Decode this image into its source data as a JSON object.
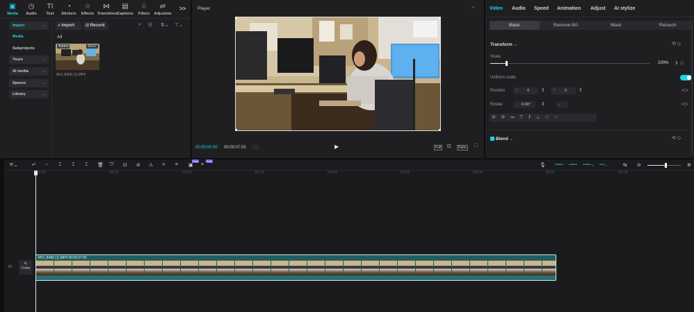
{
  "toolbar": {
    "items": [
      {
        "label": "Media",
        "icon": "media-icon",
        "glyph": "▣"
      },
      {
        "label": "Audio",
        "icon": "audio-icon",
        "glyph": "◷"
      },
      {
        "label": "Text",
        "icon": "text-icon",
        "glyph": "TI"
      },
      {
        "label": "Stickers",
        "icon": "stickers-icon",
        "glyph": "◔"
      },
      {
        "label": "Effects",
        "icon": "effects-icon",
        "glyph": "☆"
      },
      {
        "label": "Transitions",
        "icon": "transitions-icon",
        "glyph": "⋈"
      },
      {
        "label": "Captions",
        "icon": "captions-icon",
        "glyph": "▤"
      },
      {
        "label": "Filters",
        "icon": "filters-icon",
        "glyph": "♧"
      },
      {
        "label": "Adjustme",
        "icon": "adjustment-icon",
        "glyph": "⇌"
      }
    ],
    "more": ">>"
  },
  "sidebar": {
    "items": [
      {
        "label": "Import",
        "chevron": "⌄"
      },
      {
        "label": "Media",
        "chevron": ""
      },
      {
        "label": "Subprojects",
        "chevron": ""
      },
      {
        "label": "Yours",
        "chevron": "⌄"
      },
      {
        "label": "AI media",
        "chevron": "⌄"
      },
      {
        "label": "Spaces",
        "chevron": "⌄"
      },
      {
        "label": "Library",
        "chevron": "⌄"
      }
    ]
  },
  "media": {
    "import_label": "Import",
    "record_label": "Record",
    "filter_all": "All",
    "clip_badge_added": "Added",
    "clip_duration": "00:07",
    "clip_name": "MVI_8496 (1).MP4"
  },
  "player": {
    "title": "Player",
    "time_current": "00:00:00:00",
    "time_total": "00:00:07:05",
    "full_label": "Full",
    "ratio_label": "Ratio"
  },
  "inspector": {
    "tabs": [
      "Video",
      "Audio",
      "Speed",
      "Animation",
      "Adjust",
      "AI stylize"
    ],
    "subtabs": [
      "Basic",
      "Remove BG",
      "Mask",
      "Retouch"
    ],
    "transform_label": "Transform",
    "scale_label": "Scale",
    "scale_value": "100%",
    "scale_fraction": 0.1,
    "uniform_scale_label": "Uniform scale",
    "uniform_scale_on": true,
    "position_label": "Position",
    "pos_x_label": "X",
    "pos_x_value": "0",
    "pos_y_label": "Y",
    "pos_y_value": "0",
    "rotate_label": "Rotate",
    "rotate_value": "0.00°",
    "rotate_extra": "-",
    "blend_label": "Blend"
  },
  "timeline": {
    "ruler": [
      "00:00",
      "|00:01",
      "|00:02",
      "|00:03",
      "|00:04",
      "|00:05",
      "|00:06",
      "|00:07",
      "|00:08"
    ],
    "clip_label": "MVI_8496 (1).MP4  00:00:07:05",
    "cover_label": "Cover",
    "zoom_fraction": 0.55,
    "tool_badge_1": "Free",
    "tool_badge_2": "Free"
  },
  "colors": {
    "accent": "#22d3e6",
    "panel": "#1f1f22",
    "background": "#0f0f10",
    "clip": "#2b6f70"
  }
}
